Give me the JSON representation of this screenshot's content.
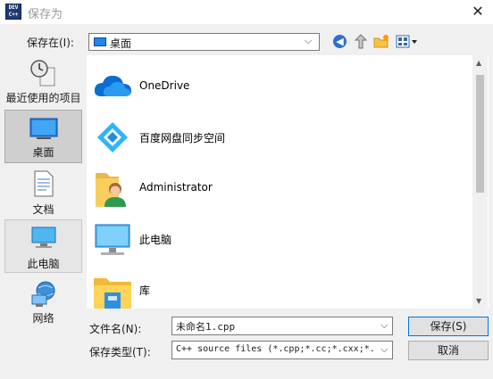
{
  "titlebar": {
    "title": "保存为",
    "close_glyph": "✕",
    "app_icon_text_1": "DEV",
    "app_icon_text_2": "C++"
  },
  "lookin": {
    "label": "保存在(I):",
    "value": "桌面",
    "chevron": "⌵"
  },
  "toolbar": {
    "back_glyph": "◀"
  },
  "places": [
    {
      "label": "最近使用的项目",
      "icon": "recent-places-icon"
    },
    {
      "label": "桌面",
      "icon": "desktop-icon"
    },
    {
      "label": "文档",
      "icon": "documents-icon"
    },
    {
      "label": "此电脑",
      "icon": "this-pc-icon"
    },
    {
      "label": "网络",
      "icon": "network-icon"
    }
  ],
  "files": [
    {
      "name": "OneDrive",
      "icon": "onedrive-icon"
    },
    {
      "name": "百度网盘同步空间",
      "icon": "baidu-netdisk-icon"
    },
    {
      "name": "Administrator",
      "icon": "user-folder-icon"
    },
    {
      "name": "此电脑",
      "icon": "computer-icon"
    },
    {
      "name": "库",
      "icon": "library-folder-icon"
    }
  ],
  "filename": {
    "label": "文件名(N):",
    "value": "未命名1.cpp",
    "chevron": "⌵"
  },
  "filetype": {
    "label": "保存类型(T):",
    "value": "C++ source files (*.cpp;*.cc;*.cxx;*.c++;*.hpp;*.hh)",
    "chevron": "⌵"
  },
  "buttons": {
    "save": "保存(S)",
    "cancel": "取消"
  },
  "colors": {
    "window_bg": "#f0f0f0",
    "selection": "#cfcfcf",
    "accent": "#0078d7"
  }
}
